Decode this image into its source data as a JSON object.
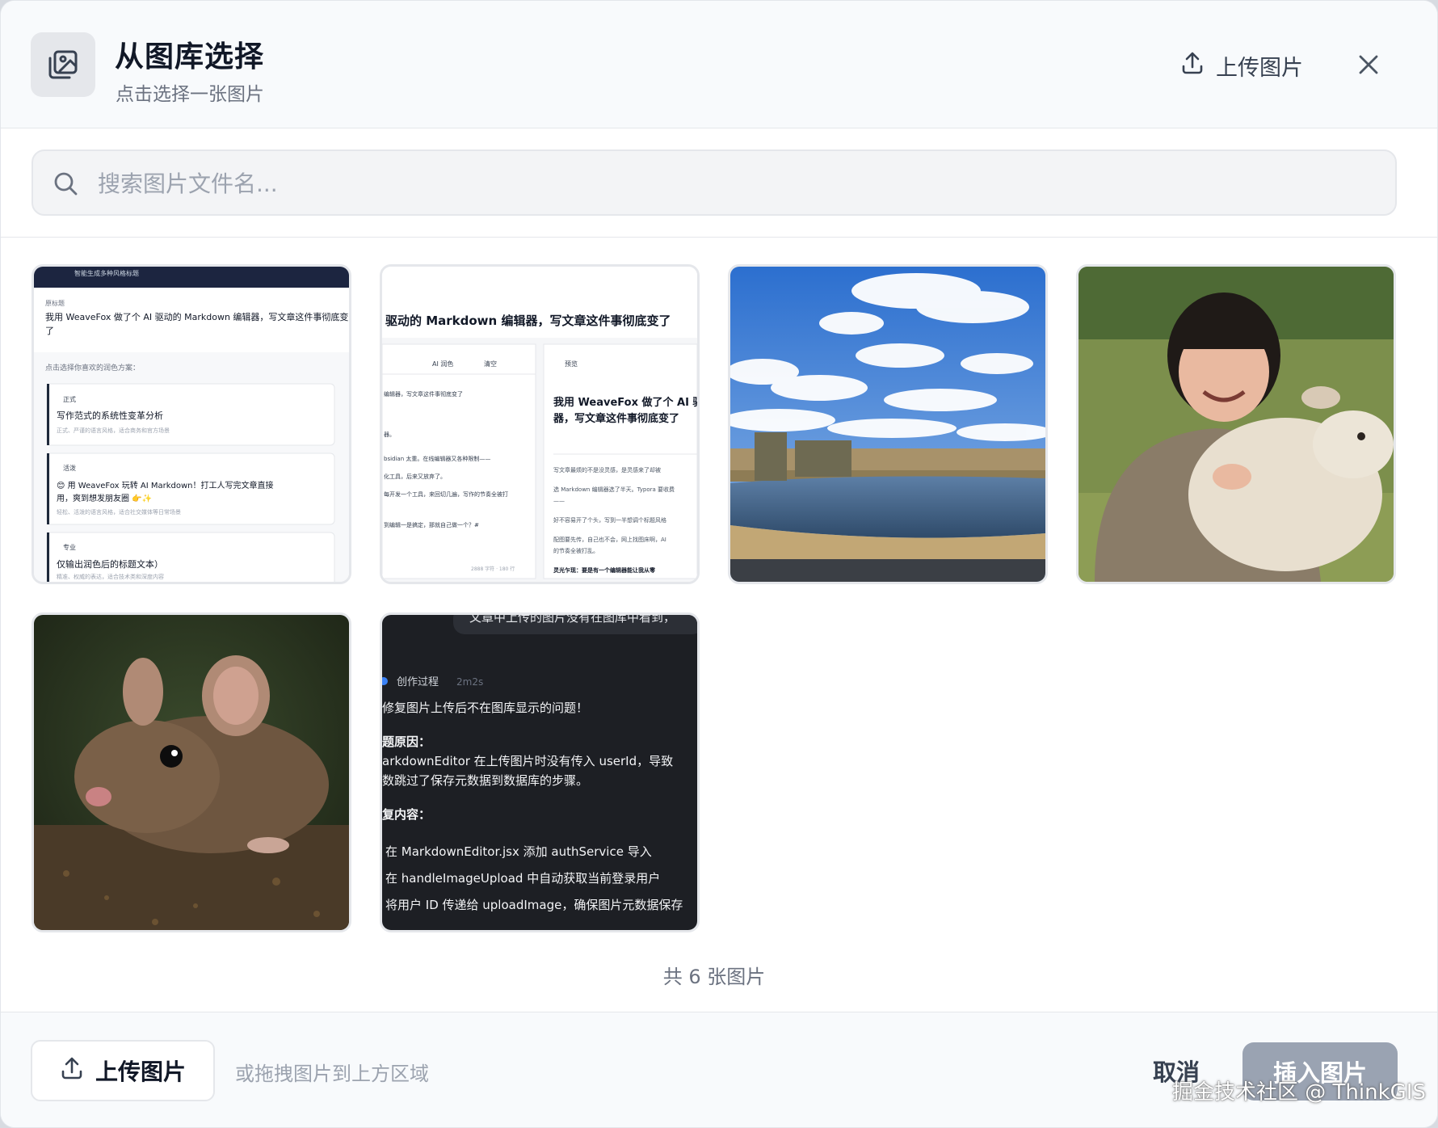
{
  "header": {
    "title": "从图库选择",
    "subtitle": "点击选择一张图片",
    "upload_label": "上传图片"
  },
  "search": {
    "placeholder": "搜索图片文件名..."
  },
  "images": [
    {
      "kind": "screenshot-light-list",
      "texts": {
        "topbar": "智能生成多种风格标题",
        "label": "原标题",
        "line1": "我用 WeaveFox 做了个 AI 驱动的 Markdown 编辑器，写文章这件事彻底变",
        "line2": "了",
        "hint": "点击选择你喜欢的润色方案：",
        "c1_tag": "正式",
        "c1_title": "写作范式的系统性变革分析",
        "c1_desc": "正式、严谨的语言风格，适合商务和官方场景",
        "c2_tag": "活泼",
        "c2_title1": "😊 用 WeaveFox 玩转 AI Markdown！打工人写完文章直接",
        "c2_title2": "用，爽到想发朋友圈 👉✨",
        "c2_desc": "轻松、活泼的语言风格，适合社交媒体等日常场景",
        "c3_tag": "专业",
        "c3_title": "仅输出润色后的标题文本）",
        "c3_desc": "精准、权威的表达，适合技术类和深度内容"
      }
    },
    {
      "kind": "screenshot-editor",
      "texts": {
        "headline": "驱动的 Markdown 编辑器，写文章这件事彻底变了",
        "tb1": "AI 润色",
        "tb2": "清空",
        "tb3": "预览",
        "l1": "编辑器，写文章这件事彻底变了",
        "l2": "器。",
        "l3": "bsidian 太重。在线编辑器又各种限制——",
        "l4": "化工具，后来又放弃了。",
        "l5": "每开发一个工具，来回切几遍，写作的节奏全被打",
        "l6": "到编辑一是搞定，那就自己做一个？#",
        "r_title1": "我用 WeaveFox 做了个 AI 驱",
        "r_title2": "器，写文章这件事彻底变了",
        "r1": "写文章最烦的不是没灵感，是灵感来了却被",
        "r2": "选 Markdown 编辑器选了半天。Typora 要收费",
        "r3": "——",
        "r4": "好不容易开了个头，写到一半想调个标题风格",
        "r5": "配图要先传，自己也不会，网上找图床啊，AI",
        "r6": "的节奏全被打乱。",
        "r7": "灵光乍现：要是有一个编辑器能让我从零",
        "footer": "2888 字符 · 180 行"
      }
    },
    {
      "kind": "photo-landscape"
    },
    {
      "kind": "photo-child-sheep"
    },
    {
      "kind": "photo-mouse"
    },
    {
      "kind": "screenshot-dark-chat",
      "texts": {
        "top": "文章中上传的图片没有在图库中看到，",
        "process": "创作过程",
        "time": "2m2s",
        "l1": "修复图片上传后不在图库显示的问题！",
        "l2": "题原因：",
        "l3": "arkdownEditor 在上传图片时没有传入 userId，导致",
        "l4": "数跳过了保存元数据到数据库的步骤。",
        "l5": "复内容：",
        "l6": "在 MarkdownEditor.jsx 添加 authService 导入",
        "l7": "在 handleImageUpload 中自动获取当前登录用户",
        "l8": "将用户 ID 传递给 uploadImage，确保图片元数据保存"
      }
    }
  ],
  "count_text": "共 6 张图片",
  "footer": {
    "upload_label": "上传图片",
    "drag_hint": "或拖拽图片到上方区域",
    "cancel_label": "取消",
    "insert_label": "插入图片"
  },
  "watermark": "掘金技术社区 @ ThinkGIS",
  "icons": {
    "header": "image-gallery-icon",
    "upload": "upload-icon",
    "close": "close-icon",
    "search": "search-icon"
  }
}
